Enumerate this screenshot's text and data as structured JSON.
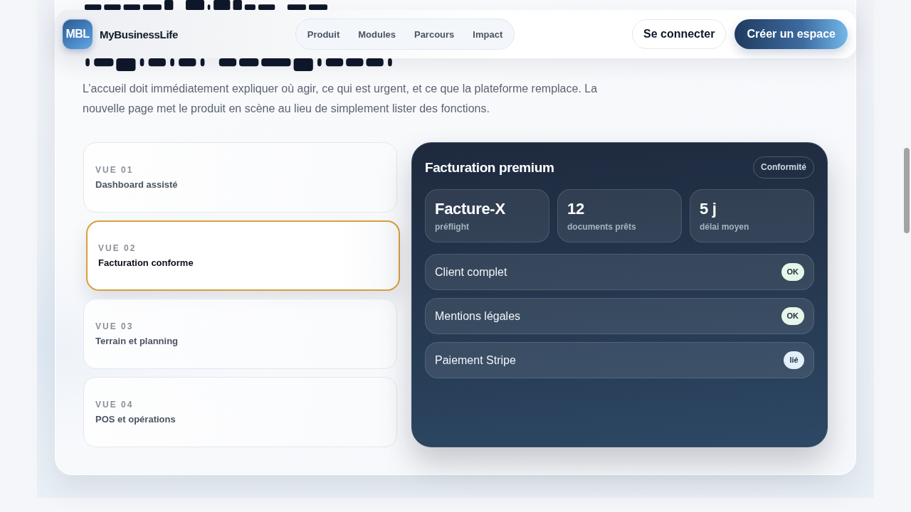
{
  "header": {
    "logo": {
      "mark": "MBL",
      "name": "MyBusinessLife"
    },
    "nav": [
      "Produit",
      "Modules",
      "Parcours",
      "Impact"
    ],
    "login": "Se connecter",
    "cta": "Créer un espace"
  },
  "hero": {
    "lead": "L’accueil doit immédiatement expliquer où agir, ce qui est urgent, et ce que la plateforme remplace. La nouvelle page met le produit en scène au lieu de simplement lister des fonctions."
  },
  "views": [
    {
      "label": "VUE 01",
      "title": "Dashboard assisté",
      "selected": false
    },
    {
      "label": "VUE 02",
      "title": "Facturation conforme",
      "selected": true
    },
    {
      "label": "VUE 03",
      "title": "Terrain et planning",
      "selected": false
    },
    {
      "label": "VUE 04",
      "title": "POS et opérations",
      "selected": false
    }
  ],
  "panel": {
    "title": "Facturation premium",
    "badge": "Conformité",
    "stats": [
      {
        "value": "Facture-X",
        "label": "préflight"
      },
      {
        "value": "12",
        "label": "documents prêts"
      },
      {
        "value": "5 j",
        "label": "délai moyen"
      }
    ],
    "checks": [
      {
        "label": "Client complet",
        "status": "OK",
        "color": "#e6f6e9"
      },
      {
        "label": "Mentions légales",
        "status": "OK",
        "color": "#e6f6e9"
      },
      {
        "label": "Paiement Stripe",
        "status": "lié",
        "color": "#e3effa"
      }
    ]
  }
}
